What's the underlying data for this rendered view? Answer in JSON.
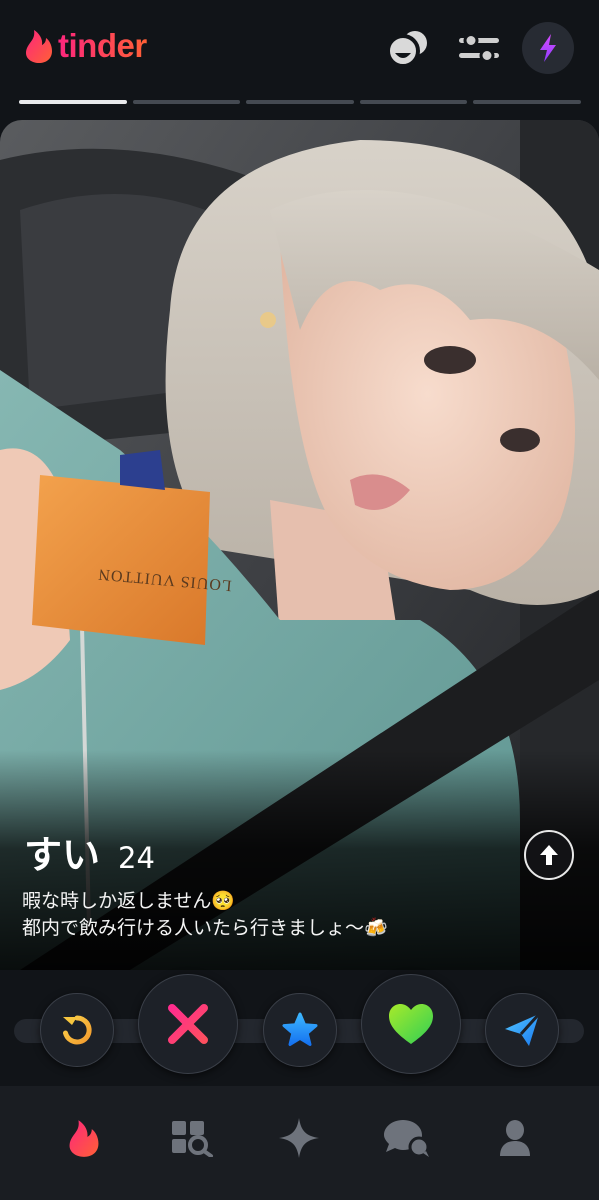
{
  "app": {
    "logo_text": "tinder",
    "brand_colors": [
      "#fd267d",
      "#ff6036"
    ]
  },
  "header": {
    "buttons": [
      {
        "name": "double-date",
        "icon": "double-date-icon"
      },
      {
        "name": "discovery-settings",
        "icon": "sliders-icon"
      },
      {
        "name": "boost",
        "icon": "lightning-bolt-icon"
      }
    ]
  },
  "photos": {
    "total": 5,
    "current": 1
  },
  "profile": {
    "name": "すい",
    "age": "24",
    "bio_line1": "暇な時しか返しません🥺",
    "bio_line2": "都内で飲み行ける人いたら行きましょ〜🍻",
    "photo_text": "LOUIS VUITTON"
  },
  "actions": [
    {
      "name": "rewind",
      "icon": "rewind-icon",
      "color": "#f5b748"
    },
    {
      "name": "nope",
      "icon": "x-icon",
      "color": "#fd267d"
    },
    {
      "name": "super-like",
      "icon": "star-icon",
      "color": "#1e9bff"
    },
    {
      "name": "like",
      "icon": "heart-icon",
      "color": "#5ddb43"
    },
    {
      "name": "super-message",
      "icon": "paper-plane-icon",
      "color": "#2a8df7"
    }
  ],
  "nav": [
    {
      "name": "discover",
      "icon": "flame-icon",
      "active": true
    },
    {
      "name": "explore",
      "icon": "grid-search-icon",
      "active": false
    },
    {
      "name": "gold",
      "icon": "sparkle-icon",
      "active": false
    },
    {
      "name": "messages",
      "icon": "chat-bubbles-icon",
      "active": false
    },
    {
      "name": "profile",
      "icon": "person-icon",
      "active": false
    }
  ]
}
